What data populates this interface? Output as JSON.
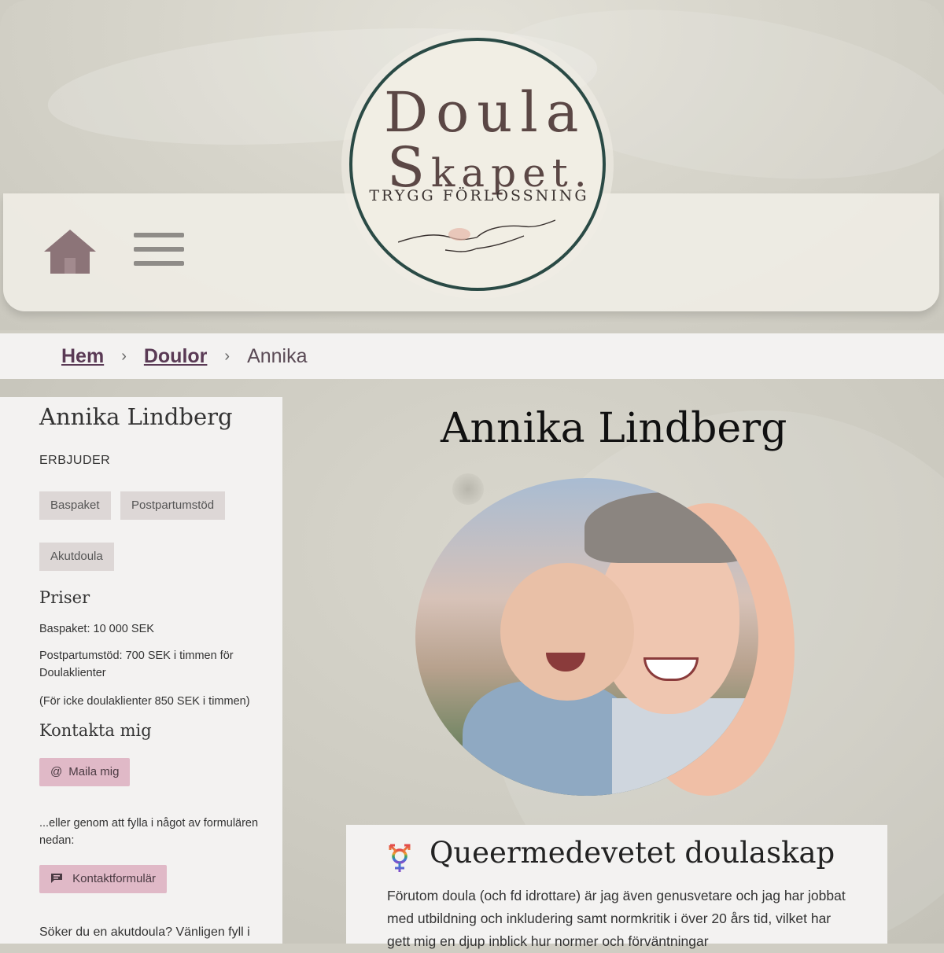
{
  "header": {
    "logo": {
      "line1": "Doula",
      "line2_initial": "S",
      "line2_rest": "kapet.",
      "tagline": "TRYGG FÖRLOSSNING"
    },
    "home_icon": "home-icon",
    "menu_icon": "hamburger-menu-icon"
  },
  "breadcrumb": {
    "items": [
      "Hem",
      "Doulor",
      "Annika"
    ],
    "separator": "›"
  },
  "sidebar": {
    "name": "Annika Lindberg",
    "offers_label": "ERBJUDER",
    "offers": [
      "Baspaket",
      "Postpartumstöd",
      "Akutdoula"
    ],
    "prices_heading": "Priser",
    "prices": [
      "Baspaket: 10 000 SEK",
      "Postpartumstöd: 700 SEK i timmen för Doulaklienter",
      "(För icke doulaklienter 850 SEK i timmen)"
    ],
    "contact_heading": "Kontakta mig",
    "email_button": "Maila mig",
    "email_icon": "@",
    "form_text": "...eller genom att fylla i något av formulären nedan:",
    "form_button": "Kontaktformulär",
    "form_icon": "chat-icon",
    "urgent_text": "Söker du en akutdoula? Vänligen fyll i"
  },
  "main": {
    "title": "Annika Lindberg",
    "card": {
      "icon": "transgender-symbol-icon",
      "title": "Queermedevetet doulaskap",
      "text": "Förutom doula (och fd idrottare) är jag även genusvetare och jag har jobbat med utbildning och inkludering samt normkritik i över 20 års tid, vilket har gett mig en djup inblick hur normer och förväntningar"
    }
  },
  "colors": {
    "accent_pink": "#e0b9c7",
    "tag_bg": "#ddd7d6",
    "panel_bg": "#f3f2f1",
    "logo_ring": "#2a4a45",
    "photo_accent": "#f0bfa6"
  }
}
